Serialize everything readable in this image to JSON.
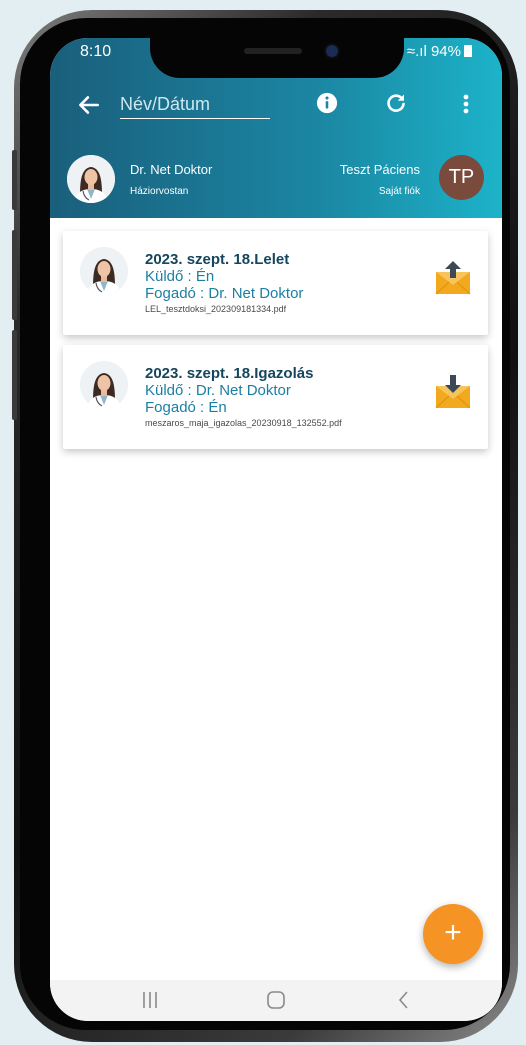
{
  "status_bar": {
    "time": "8:10",
    "signal": "≈.ıl",
    "battery": "94%"
  },
  "toolbar": {
    "search_placeholder": "Név/Dátum",
    "back_icon": "arrow-left-icon",
    "info_icon": "info-icon",
    "refresh_icon": "refresh-icon",
    "more_icon": "more-vertical-icon"
  },
  "profile": {
    "doctor_name": "Dr. Net Doktor",
    "doctor_role": "Háziorvostan",
    "patient_name": "Teszt Páciens",
    "patient_role": "Saját fiók",
    "patient_initials": "TP"
  },
  "messages": [
    {
      "title": "2023. szept. 18.Lelet",
      "sender": "Küldő : Én",
      "receiver": "Fogadó : Dr. Net Doktor",
      "file": "LEL_tesztdoksi_202309181334.pdf",
      "direction": "upload"
    },
    {
      "title": "2023. szept. 18.Igazolás",
      "sender": "Küldő : Dr. Net Doktor",
      "receiver": "Fogadó : Én",
      "file": "meszaros_maja_igazolas_20230918_132552.pdf",
      "direction": "download"
    }
  ],
  "fab": {
    "label": "+"
  },
  "colors": {
    "header_start": "#1a5f7c",
    "header_end": "#1cb3c9",
    "accent": "#f59324",
    "title_text": "#15465e",
    "link_text": "#1b7fa1",
    "patient_avatar": "#7a4a3d"
  }
}
